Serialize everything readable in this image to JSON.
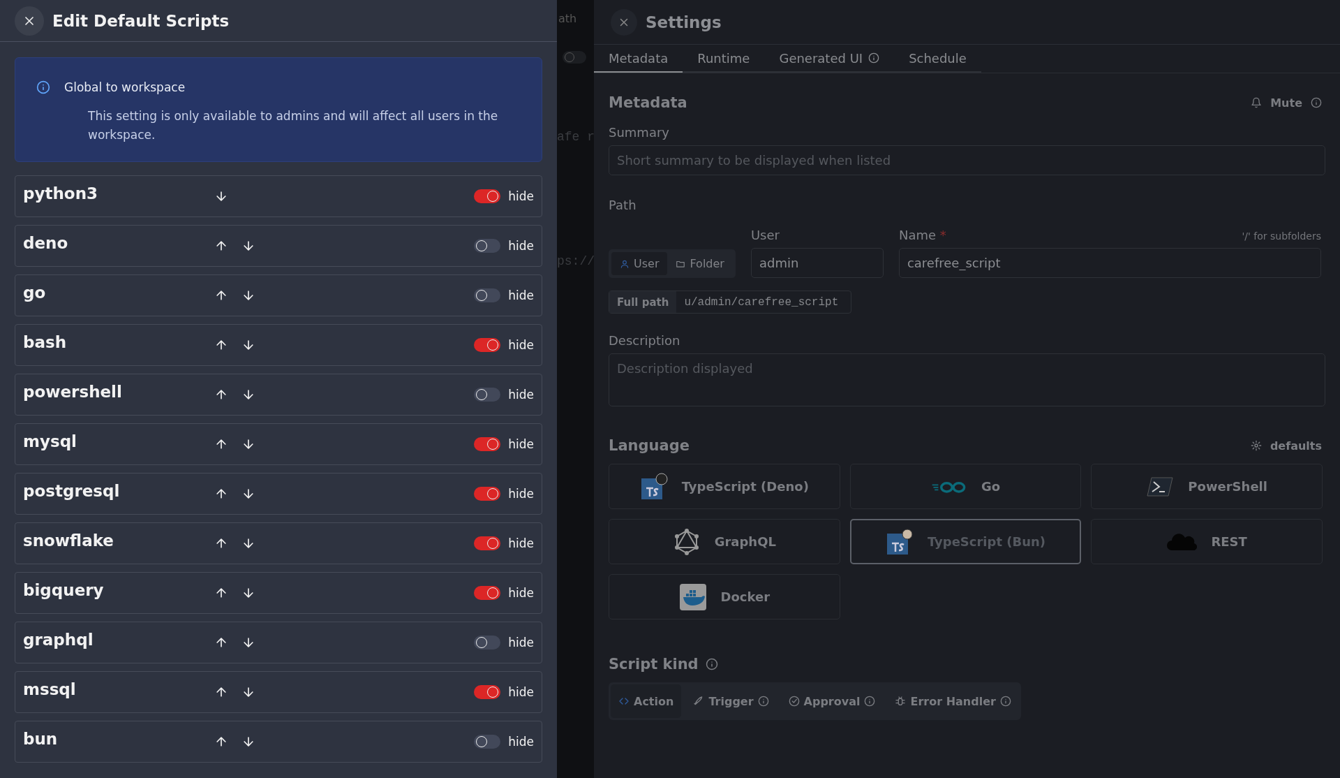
{
  "backdrop": {
    "texts": [
      "ath",
      "afe r",
      "ps://"
    ],
    "toggle_on": false
  },
  "drawer": {
    "title": "Edit Default Scripts",
    "alert": {
      "title": "Global to workspace",
      "body": "This setting is only available to admins and will affect all users in the workspace."
    },
    "scripts": [
      {
        "name": "python3",
        "up": false,
        "down": true,
        "on": true,
        "toggle_label": "hide"
      },
      {
        "name": "deno",
        "up": true,
        "down": true,
        "on": false,
        "toggle_label": "hide"
      },
      {
        "name": "go",
        "up": true,
        "down": true,
        "on": false,
        "toggle_label": "hide"
      },
      {
        "name": "bash",
        "up": true,
        "down": true,
        "on": true,
        "toggle_label": "hide"
      },
      {
        "name": "powershell",
        "up": true,
        "down": true,
        "on": false,
        "toggle_label": "hide"
      },
      {
        "name": "mysql",
        "up": true,
        "down": true,
        "on": true,
        "toggle_label": "hide"
      },
      {
        "name": "postgresql",
        "up": true,
        "down": true,
        "on": true,
        "toggle_label": "hide"
      },
      {
        "name": "snowflake",
        "up": true,
        "down": true,
        "on": true,
        "toggle_label": "hide"
      },
      {
        "name": "bigquery",
        "up": true,
        "down": true,
        "on": true,
        "toggle_label": "hide"
      },
      {
        "name": "graphql",
        "up": true,
        "down": true,
        "on": false,
        "toggle_label": "hide"
      },
      {
        "name": "mssql",
        "up": true,
        "down": true,
        "on": true,
        "toggle_label": "hide"
      },
      {
        "name": "bun",
        "up": true,
        "down": true,
        "on": false,
        "toggle_label": "hide"
      }
    ]
  },
  "settings": {
    "title": "Settings",
    "tabs": [
      {
        "label": "Metadata",
        "selected": true,
        "info": false
      },
      {
        "label": "Runtime",
        "selected": false,
        "info": false
      },
      {
        "label": "Generated UI",
        "selected": false,
        "info": true
      },
      {
        "label": "Schedule",
        "selected": false,
        "info": false
      }
    ],
    "heading": "Metadata",
    "mute": "Mute",
    "summary": {
      "label": "Summary",
      "placeholder": "Short summary to be displayed when listed"
    },
    "path": {
      "label": "Path",
      "owner_options": [
        {
          "label": "User",
          "selected": true
        },
        {
          "label": "Folder",
          "selected": false
        }
      ],
      "user_label": "User",
      "user_value": "admin",
      "name_label": "Name",
      "required_mark": "*",
      "name_hint": "'/' for subfolders",
      "name_value": "carefree_script",
      "full_path_label": "Full path",
      "full_path": "u/admin/carefree_script"
    },
    "description": {
      "label": "Description",
      "placeholder": "Description displayed"
    },
    "language": {
      "heading": "Language",
      "defaults": "defaults",
      "options": [
        {
          "name": "TypeScript (Deno)",
          "selected": false
        },
        {
          "name": "Go",
          "selected": false
        },
        {
          "name": "PowerShell",
          "selected": false
        },
        {
          "name": "GraphQL",
          "selected": false
        },
        {
          "name": "TypeScript (Bun)",
          "selected": true
        },
        {
          "name": "REST",
          "selected": false
        },
        {
          "name": "Docker",
          "selected": false
        }
      ]
    },
    "script_kind": {
      "heading": "Script kind",
      "options": [
        {
          "label": "Action",
          "selected": true,
          "info": false
        },
        {
          "label": "Trigger",
          "selected": false,
          "info": true
        },
        {
          "label": "Approval",
          "selected": false,
          "info": true
        },
        {
          "label": "Error Handler",
          "selected": false,
          "info": true
        }
      ]
    }
  }
}
